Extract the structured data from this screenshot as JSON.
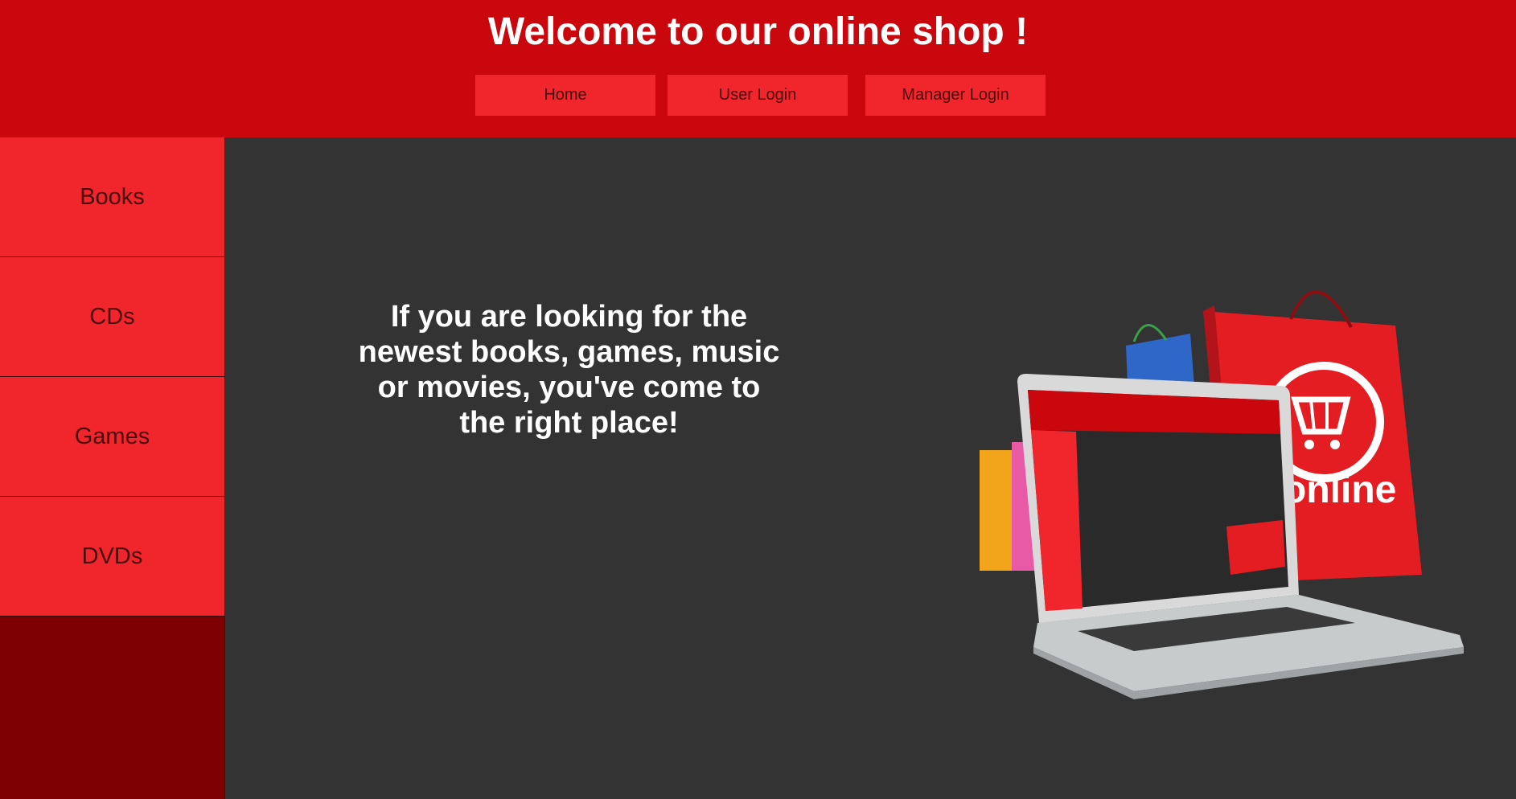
{
  "header": {
    "title": "Welcome to our online shop !",
    "nav": [
      "Home",
      "User Login",
      "Manager Login"
    ]
  },
  "sidebar": {
    "items": [
      "Books",
      "CDs",
      "Games",
      "DVDs"
    ]
  },
  "main": {
    "tagline": "If you are looking for the newest books, games, music or movies, you've come to the right place!",
    "hero_text": "online"
  },
  "colors": {
    "header_bg": "#c9070d",
    "button_bg": "#f1262d",
    "sidebar_footer": "#7d0003",
    "main_bg": "#333333"
  }
}
